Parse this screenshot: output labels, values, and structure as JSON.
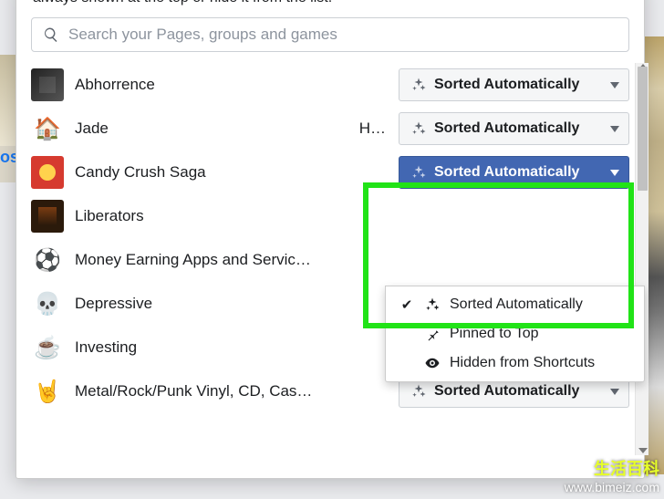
{
  "header": {
    "hint": "always shown at the top or hide it from the list."
  },
  "search": {
    "placeholder": "Search your Pages, groups and games"
  },
  "sort_label_default": "Sorted Automatically",
  "items": [
    {
      "name": "Abhorrence",
      "extra": ""
    },
    {
      "name": "Jade",
      "extra": "H…"
    },
    {
      "name": "Candy Crush Saga",
      "extra": ""
    },
    {
      "name": "Liberators",
      "extra": ""
    },
    {
      "name": "Money Earning Apps and Servic…",
      "extra": ""
    },
    {
      "name": "Depressive",
      "extra": ""
    },
    {
      "name": "Investing",
      "extra": ""
    },
    {
      "name": "Metal/Rock/Punk Vinyl, CD, Cas…",
      "extra": ""
    }
  ],
  "menu": {
    "sorted": "Sorted Automatically",
    "pinned": "Pinned to Top",
    "hidden": "Hidden from Shortcuts"
  },
  "watermark": {
    "cn": "生活百科",
    "url": "www.bimeiz.com"
  },
  "sidecrumb": "os"
}
